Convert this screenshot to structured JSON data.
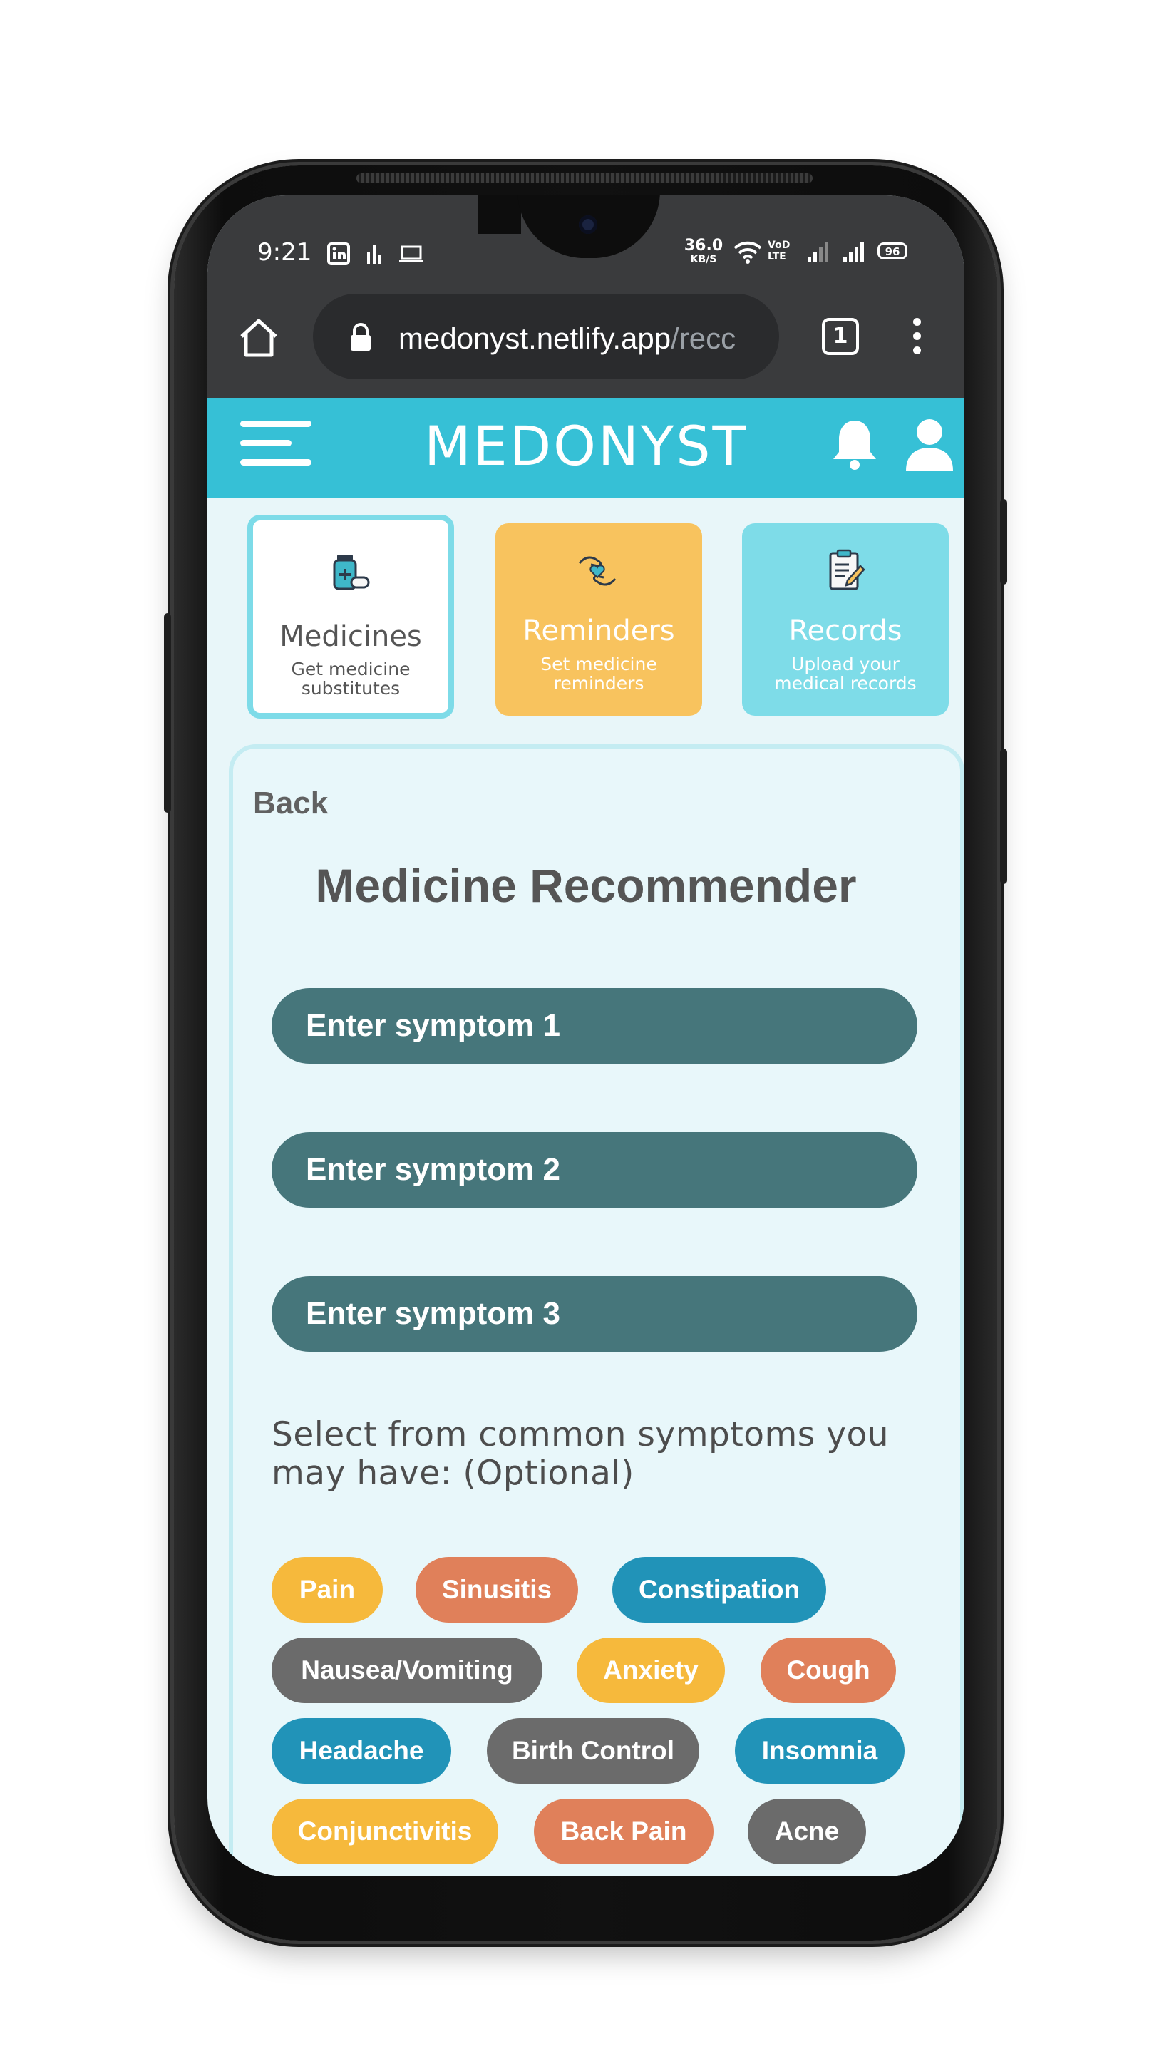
{
  "status_bar": {
    "time": "9:21",
    "net_speed_value": "36.0",
    "net_speed_unit": "KB/S",
    "volte_label": "VoD LTE",
    "battery": "96"
  },
  "browser": {
    "url_main": "medonyst.netlify.app",
    "url_rest": "/recc",
    "tab_count": "1"
  },
  "app": {
    "brand": "MEDONYST"
  },
  "cards": [
    {
      "title": "Medicines",
      "sub_line1": "Get medicine",
      "sub_line2": "substitutes",
      "icon": "medicine-bottle-icon"
    },
    {
      "title": "Reminders",
      "sub_line1": "Set medicine",
      "sub_line2": "reminders",
      "icon": "hands-heart-icon"
    },
    {
      "title": "Records",
      "sub_line1": "Upload your",
      "sub_line2": "medical records",
      "icon": "clipboard-icon"
    }
  ],
  "recommender": {
    "back_label": "Back",
    "title": "Medicine Recommender",
    "inputs": [
      "Enter symptom 1",
      "Enter symptom 2",
      "Enter symptom 3"
    ],
    "hint_line1": "Select from common symptoms you",
    "hint_line2": "may have: (Optional)",
    "chips": [
      "Pain",
      "Sinusitis",
      "Constipation",
      "Nausea/Vomiting",
      "Anxiety",
      "Cough",
      "Headache",
      "Birth Control",
      "Insomnia",
      "Conjunctivitis",
      "Back Pain",
      "Acne"
    ]
  },
  "colors": {
    "accent": "#36c0d6",
    "reminders_card": "#f8c35e",
    "records_card": "#7edce8",
    "input_bg": "#46767b",
    "chip_yellow": "#f6b93c",
    "chip_orange": "#e0805a",
    "chip_blue": "#2193b8",
    "chip_gray": "#6b6b6b"
  }
}
